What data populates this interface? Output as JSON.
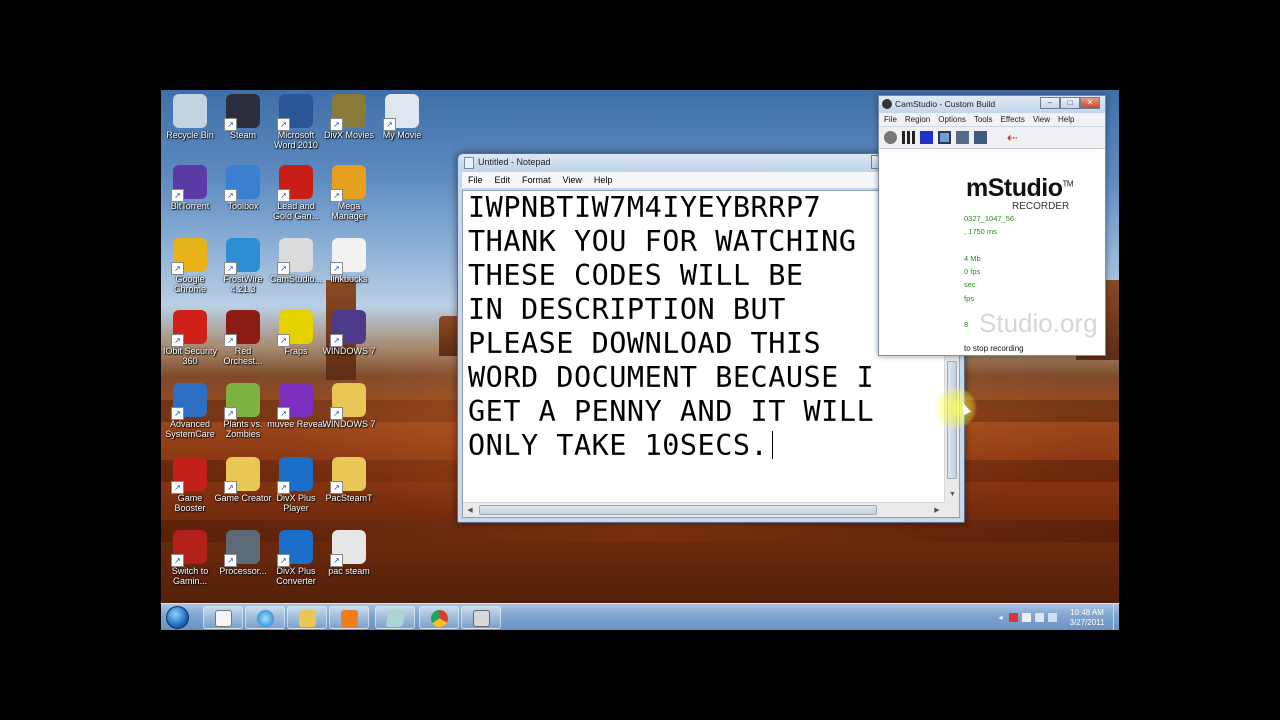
{
  "desktop": {
    "icons": [
      {
        "label": "Recycle Bin",
        "icon": "recycle-bin-icon",
        "color": "#c5d3e0"
      },
      {
        "label": "Steam",
        "icon": "steam-icon",
        "color": "#2a2f3a"
      },
      {
        "label": "Microsoft Word 2010",
        "icon": "word-icon",
        "color": "#2b5797"
      },
      {
        "label": "DivX Movies",
        "icon": "divx-movies-icon",
        "color": "#8a7a3a"
      },
      {
        "label": "My Movie",
        "icon": "wmv-file-icon",
        "color": "#dfe6ef"
      },
      {
        "label": "BitTorrent",
        "icon": "bittorrent-icon",
        "color": "#5b3aa8"
      },
      {
        "label": "Toolbox",
        "icon": "toolbox-icon",
        "color": "#3a7fd0"
      },
      {
        "label": "Lead and Gold Gan...",
        "icon": "lead-and-gold-icon",
        "color": "#c81e16"
      },
      {
        "label": "Mega Manager",
        "icon": "mega-manager-icon",
        "color": "#e6a020"
      },
      {
        "label": "Google Chrome",
        "icon": "chrome-icon",
        "color": "#e8b319"
      },
      {
        "label": "FrostWire 4.21.3",
        "icon": "frostwire-icon",
        "color": "#2c8fd6"
      },
      {
        "label": "CamStudio...",
        "icon": "camstudio-icon",
        "color": "#dcdcdc"
      },
      {
        "label": "linkbucks",
        "icon": "text-file-icon",
        "color": "#f2f2f2"
      },
      {
        "label": "IObit Security 360",
        "icon": "iobit-security-icon",
        "color": "#d0201a"
      },
      {
        "label": "Red Orchest...",
        "icon": "red-orchestra-icon",
        "color": "#8a1a12"
      },
      {
        "label": "Fraps",
        "icon": "fraps-icon",
        "color": "#e3d200"
      },
      {
        "label": "WINDOWS 7",
        "icon": "rar-archive-icon",
        "color": "#4d3a8a"
      },
      {
        "label": "Advanced SystemCare",
        "icon": "advanced-systemcare-icon",
        "color": "#2d6fc4"
      },
      {
        "label": "Plants vs. Zombies",
        "icon": "plants-vs-zombies-icon",
        "color": "#7cb341"
      },
      {
        "label": "muvee Reveal",
        "icon": "muvee-reveal-icon",
        "color": "#7b2fbf"
      },
      {
        "label": "WINDOWS 7",
        "icon": "folder-icon",
        "color": "#e8c757"
      },
      {
        "label": "Game Booster",
        "icon": "game-booster-icon",
        "color": "#c32019"
      },
      {
        "label": "Game Creator",
        "icon": "folder-icon",
        "color": "#e8c757"
      },
      {
        "label": "DivX Plus Player",
        "icon": "divx-player-icon",
        "color": "#1b6fc9"
      },
      {
        "label": "PacSteamT",
        "icon": "folder-icon",
        "color": "#e8c757"
      },
      {
        "label": "Switch to Gamin...",
        "icon": "switch-gaming-icon",
        "color": "#b22018"
      },
      {
        "label": "Processor...",
        "icon": "processor-icon",
        "color": "#5d6a78"
      },
      {
        "label": "DivX Plus Converter",
        "icon": "divx-converter-icon",
        "color": "#1b6fc9"
      },
      {
        "label": "pac steam",
        "icon": "avi-file-icon",
        "color": "#e6e6e6"
      }
    ]
  },
  "notepad": {
    "title": "Untitled - Notepad",
    "menu": [
      "File",
      "Edit",
      "Format",
      "View",
      "Help"
    ],
    "lines": [
      "IWPNBTIW7M4IYEYBRRP7",
      "THANK YOU FOR WATCHING",
      "THESE CODES WILL BE",
      "IN DESCRIPTION BUT",
      "PLEASE DOWNLOAD THIS",
      "WORD DOCUMENT BECAUSE I",
      "GET A PENNY AND IT WILL",
      "ONLY TAKE 10SECS."
    ],
    "minimize": "–",
    "maximize": "□",
    "close": "✕"
  },
  "camstudio": {
    "title": "CamStudio - Custom Build",
    "menu": [
      "File",
      "Region",
      "Options",
      "Tools",
      "Effects",
      "View",
      "Help"
    ],
    "logo": "mStudio",
    "logo_tm": "TM",
    "logo_sub": "RECORDER",
    "info_lines": [
      "0327_1047_56",
      ", 1750 ms",
      "",
      "4 Mb",
      "0 fps",
      "sec",
      "fps",
      "8"
    ],
    "watermark": "Studio.org",
    "status": "to stop recording",
    "minimize": "–",
    "maximize": "□",
    "close": "✕"
  },
  "taskbar": {
    "clock_time": "10:48 AM",
    "clock_date": "3/27/2011",
    "tray_arrow": "◂"
  }
}
